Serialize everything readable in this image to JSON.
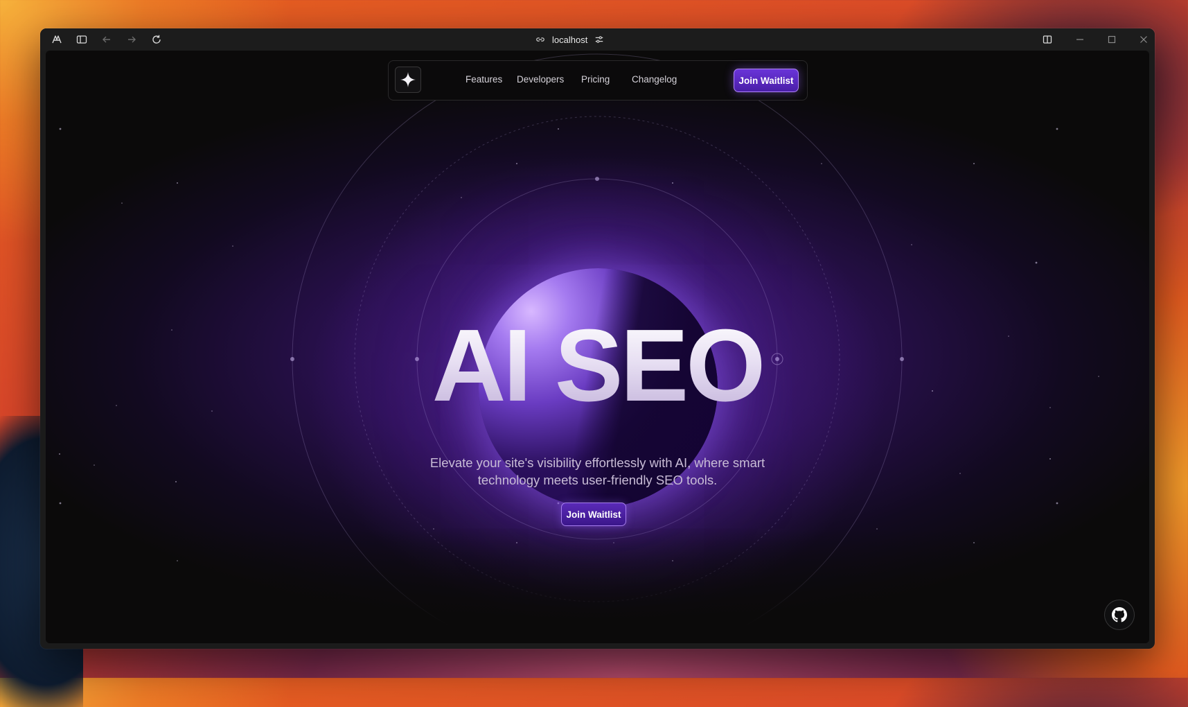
{
  "browser": {
    "address_text": "localhost",
    "icons": [
      "browser-logo-icon",
      "sidebar-toggle-icon",
      "back-arrow-icon",
      "forward-arrow-icon",
      "reload-icon",
      "link-icon",
      "site-settings-icon",
      "split-view-icon",
      "minimize-icon",
      "maximize-icon",
      "close-icon"
    ]
  },
  "nav": {
    "logo_icon": "sparkle-icon",
    "links": [
      "Features",
      "Developers",
      "Pricing",
      "Changelog"
    ],
    "cta_label": "Join Waitlist"
  },
  "hero": {
    "title": "AI SEO",
    "subtitle": "Elevate your site's visibility effortlessly with AI, where smart technology meets user-friendly SEO tools.",
    "cta_label": "Join Waitlist"
  },
  "footer": {
    "github_icon": "github-icon"
  },
  "colors": {
    "accent": "#5a2ab8",
    "accent_border": "#be96ff",
    "page_background": "#0b0a0a",
    "hero_glow": "#3d1a6e"
  }
}
